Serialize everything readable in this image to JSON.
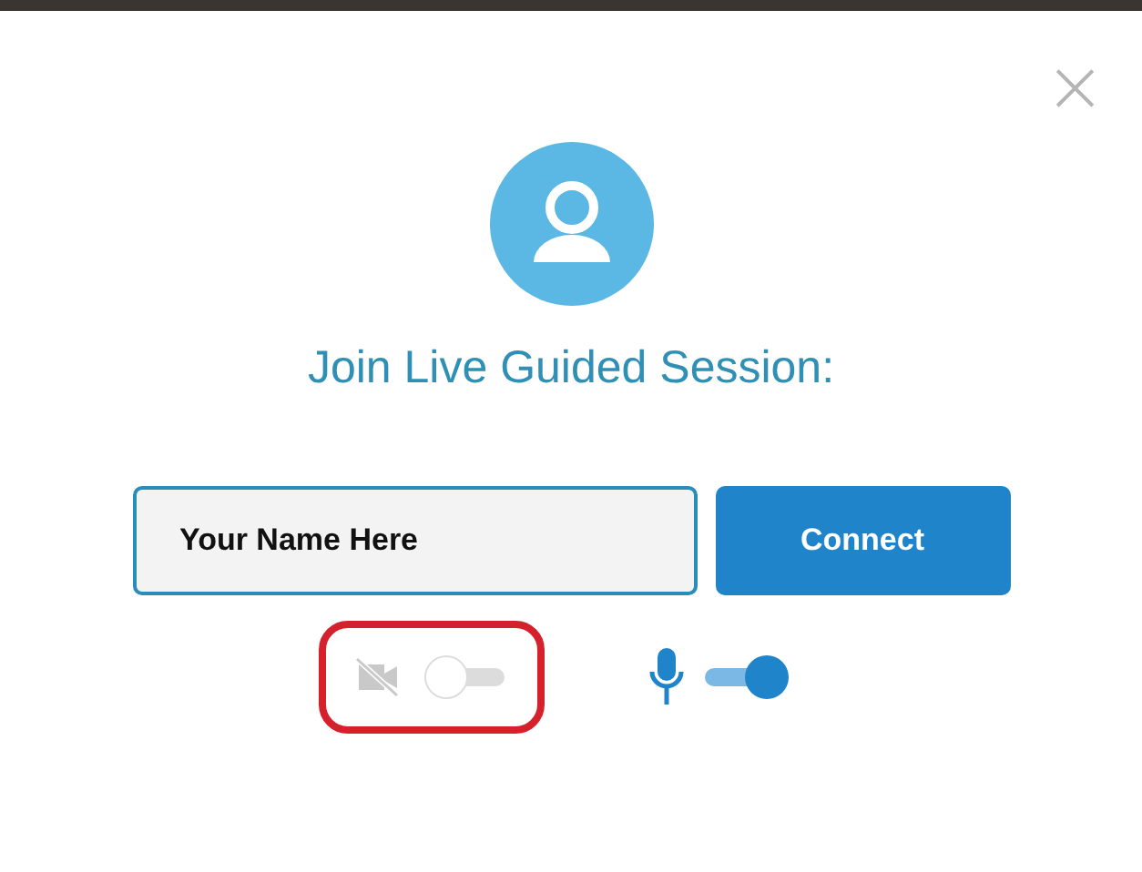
{
  "dialog": {
    "close": "×",
    "title": "Join Live Guided Session:",
    "name_field": {
      "value": "Your Name Here"
    },
    "connect_button": "Connect",
    "toggles": [
      {
        "kind": "camera",
        "on": false,
        "highlighted": true
      },
      {
        "kind": "microphone",
        "on": true,
        "highlighted": false
      }
    ]
  }
}
